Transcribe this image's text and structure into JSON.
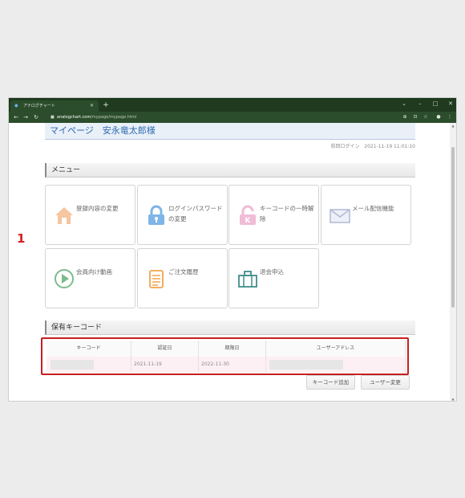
{
  "browser": {
    "tab_title": "アナログチャート",
    "new_tab": "+",
    "url_host": "analogchart.com",
    "url_path": "/mypage/mypage.html"
  },
  "page": {
    "title": "マイページ　安永竜太郎様",
    "last_login_label": "前回ログイン",
    "last_login_time": "2021-11-19 11:01:10"
  },
  "menu": {
    "heading": "メニュー",
    "items": [
      {
        "label": "登録内容の変更",
        "icon": "house-icon"
      },
      {
        "label": "ログインパスワードの変更",
        "icon": "lock-icon"
      },
      {
        "label": "キーコードの一時解除",
        "icon": "key-lock-icon"
      },
      {
        "label": "メール配信機能",
        "icon": "envelope-icon"
      },
      {
        "label": "会員向け動画",
        "icon": "play-icon"
      },
      {
        "label": "ご注文履歴",
        "icon": "document-icon"
      },
      {
        "label": "退会申込",
        "icon": "suitcase-icon"
      }
    ]
  },
  "keycodes": {
    "heading": "保有キーコード",
    "marker": "1",
    "columns": [
      "キーコード",
      "認証日",
      "期限日",
      "ユーザーアドレス"
    ],
    "rows": [
      {
        "keycode": "",
        "auth_date": "2021-11-19",
        "expiry_date": "2022-11-30",
        "user_address": ""
      }
    ],
    "add_button": "キーコード追加",
    "change_user_button": "ユーザー変更"
  },
  "colors": {
    "accent": "#2f68b0",
    "highlight_border": "#c81e1e",
    "row_background": "#fdf0f4"
  }
}
